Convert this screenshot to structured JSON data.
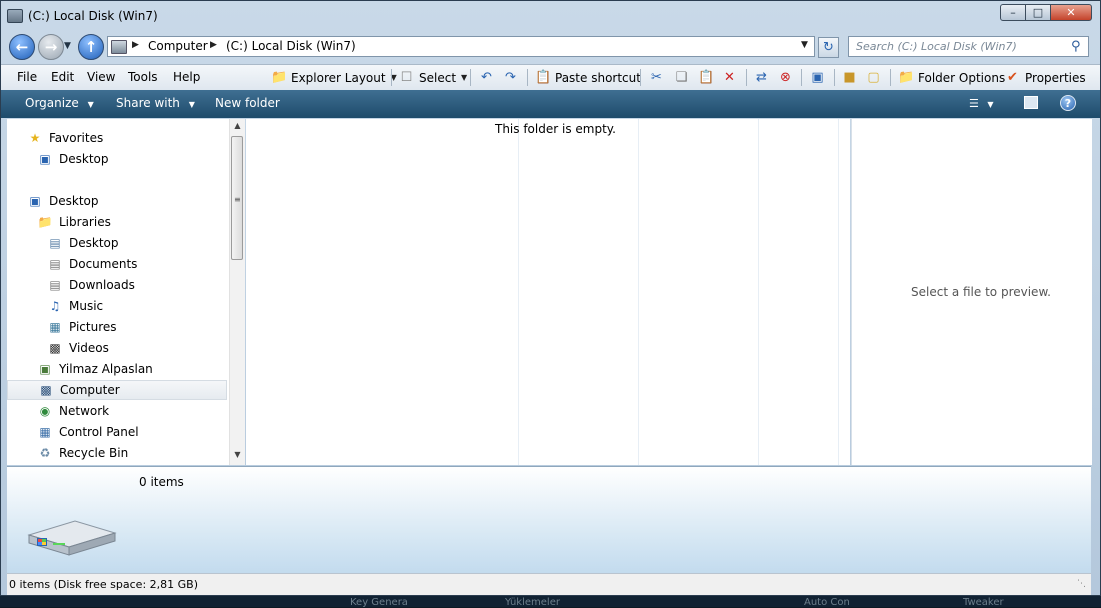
{
  "window": {
    "title": "(C:) Local Disk (Win7)",
    "controls": {
      "minimize": "–",
      "maximize": "□",
      "close": "✕"
    }
  },
  "address": {
    "segments": [
      "Computer",
      "(C:) Local Disk (Win7)"
    ],
    "icons": {
      "back": "back-arrow-icon",
      "forward": "forward-arrow-icon",
      "up": "up-arrow-icon",
      "refresh": "refresh-icon"
    }
  },
  "search": {
    "placeholder": "Search (C:) Local Disk (Win7)"
  },
  "menu": [
    "File",
    "Edit",
    "View",
    "Tools",
    "Help"
  ],
  "toolbar": {
    "explorer_layout": "Explorer Layout",
    "select": "Select",
    "paste_shortcut": "Paste shortcut",
    "folder_options": "Folder Options",
    "properties": "Properties"
  },
  "commandbar": {
    "organize": "Organize",
    "share_with": "Share with",
    "new_folder": "New folder",
    "help": "?"
  },
  "navigation": {
    "items": [
      {
        "label": "Favorites",
        "icon": "star-icon",
        "indent": 0
      },
      {
        "label": "Desktop",
        "icon": "desktop-icon",
        "indent": 1
      },
      {
        "label": "Desktop",
        "icon": "desktop-icon",
        "indent": 0
      },
      {
        "label": "Libraries",
        "icon": "libraries-icon",
        "indent": 1
      },
      {
        "label": "Desktop",
        "icon": "desktop-library-icon",
        "indent": 2
      },
      {
        "label": "Documents",
        "icon": "documents-icon",
        "indent": 2
      },
      {
        "label": "Downloads",
        "icon": "downloads-icon",
        "indent": 2
      },
      {
        "label": "Music",
        "icon": "music-icon",
        "indent": 2
      },
      {
        "label": "Pictures",
        "icon": "pictures-icon",
        "indent": 2
      },
      {
        "label": "Videos",
        "icon": "videos-icon",
        "indent": 2
      },
      {
        "label": "Yilmaz Alpaslan",
        "icon": "user-folder-icon",
        "indent": 1
      },
      {
        "label": "Computer",
        "icon": "computer-icon",
        "indent": 1,
        "selected": true
      },
      {
        "label": "Network",
        "icon": "network-icon",
        "indent": 1
      },
      {
        "label": "Control Panel",
        "icon": "control-panel-icon",
        "indent": 1
      },
      {
        "label": "Recycle Bin",
        "icon": "recycle-bin-icon",
        "indent": 1
      }
    ]
  },
  "content": {
    "empty_message": "This folder is empty."
  },
  "preview": {
    "message": "Select a file to preview."
  },
  "details": {
    "items_count": "0 items",
    "icon": "hard-drive-icon"
  },
  "status": {
    "text": "0 items (Disk free space: 2,81 GB)"
  },
  "desktop_behind": [
    "Key Genera",
    "Yüklemeler",
    "Auto Con",
    "Tweaker"
  ]
}
